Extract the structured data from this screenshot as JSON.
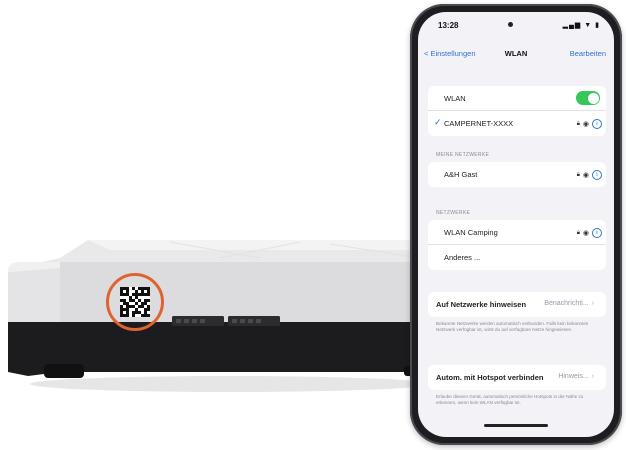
{
  "phone": {
    "status_time": "13:28",
    "status_icons": "▂▄▆ ▼ ▮",
    "nav": {
      "back_label": "< Einstellungen",
      "title": "WLAN",
      "edit_label": "Bearbeiten"
    },
    "wlan_row": {
      "label": "WLAN",
      "toggle_on": true
    },
    "connected_network": {
      "label": "CAMPERNET-XXXX"
    },
    "my_networks": {
      "header": "MEINE NETZWERKE",
      "items": [
        {
          "label": "A&H Gast"
        }
      ]
    },
    "networks": {
      "header": "NETZWERKE",
      "items": [
        {
          "label": "WLAN Camping"
        }
      ],
      "other_label": "Anderes ..."
    },
    "ask_to_join": {
      "label": "Auf Netzwerke hinweisen",
      "value": "Benachrichti...",
      "footnote": "Bekannte Netzwerke werden automatisch verbunden. Falls kein bekanntes Netzwerk verfügbar ist, wirst du auf verfügbare Netze hingewiesen."
    },
    "auto_hotspot": {
      "label": "Autom. mit Hotspot verbinden",
      "value": "Hinweis...",
      "footnote": "Erlaube diesem Gerät, automatisch persönliche Hotspots in der Nähe zu erkennen, wenn kein WLAN verfügbar ist."
    }
  },
  "icons": {
    "lock": "lock-icon",
    "wifi": "wifi-icon",
    "info": "info-icon",
    "check": "checkmark-icon",
    "chevron": "chevron-right-icon"
  },
  "colors": {
    "accent": "#2f74d0",
    "toggle_on": "#34c759",
    "qr_circle": "#e0632f"
  }
}
